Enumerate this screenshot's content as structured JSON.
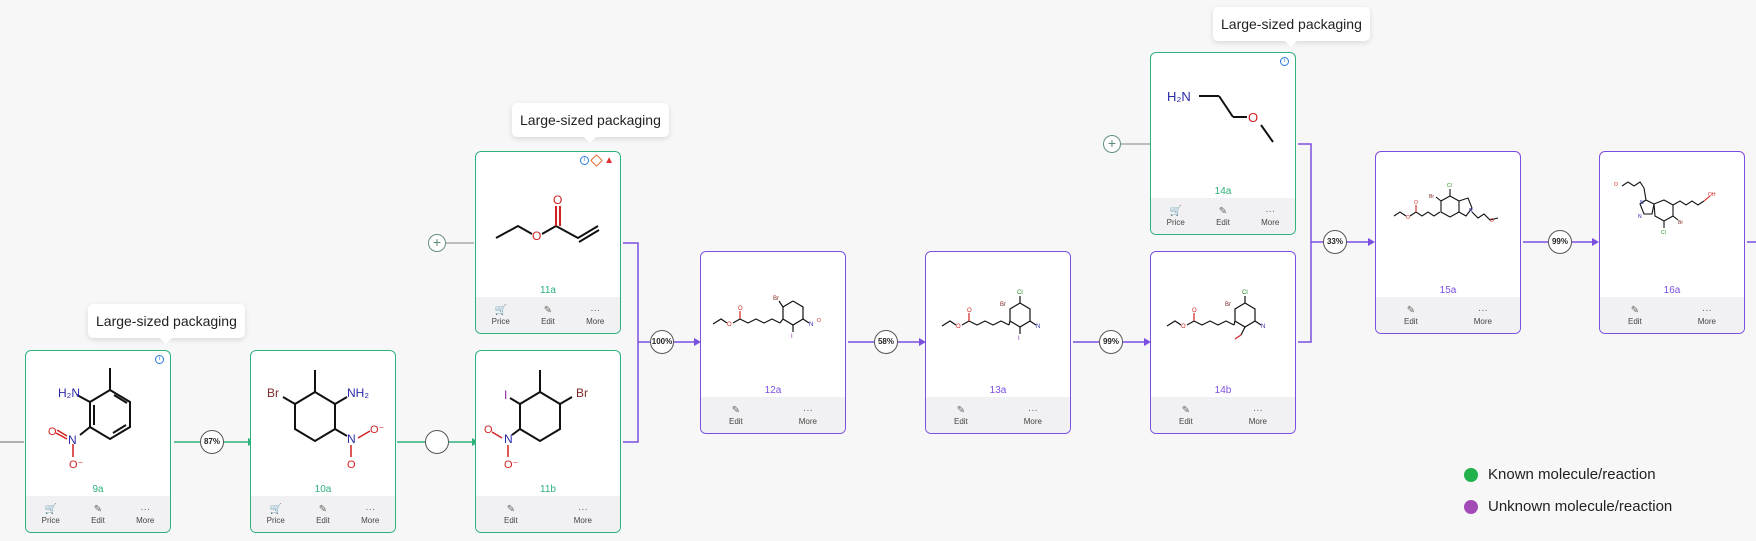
{
  "tooltip_text": "Large-sized packaging",
  "actions": {
    "price": "Price",
    "edit": "Edit",
    "more": "More"
  },
  "molecules": {
    "9a": {
      "label": "9a",
      "status": "known"
    },
    "10a": {
      "label": "10a",
      "status": "known"
    },
    "11a": {
      "label": "11a",
      "status": "known"
    },
    "11b": {
      "label": "11b",
      "status": "known"
    },
    "12a": {
      "label": "12a",
      "status": "unknown"
    },
    "13a": {
      "label": "13a",
      "status": "unknown"
    },
    "14a": {
      "label": "14a",
      "status": "known"
    },
    "14b": {
      "label": "14b",
      "status": "unknown"
    },
    "15a": {
      "label": "15a",
      "status": "unknown"
    },
    "16a": {
      "label": "16a",
      "status": "unknown"
    }
  },
  "reactions": {
    "r_9a_10a": {
      "yield": "87%"
    },
    "r_10a_11b": {
      "yield": ""
    },
    "r_11_12a": {
      "yield": "100%"
    },
    "r_12a_13a": {
      "yield": "58%"
    },
    "r_13a_14b": {
      "yield": "99%"
    },
    "r_14_15a": {
      "yield": "33%"
    },
    "r_15a_16a": {
      "yield": "99%"
    }
  },
  "legend": {
    "known": {
      "label": "Known molecule/reaction",
      "color": "#22b14c"
    },
    "unknown": {
      "label": "Unknown molecule/reaction",
      "color": "#a24ab6"
    }
  },
  "colors": {
    "known": "#2fb17c",
    "unknown": "#7b4fe0"
  }
}
